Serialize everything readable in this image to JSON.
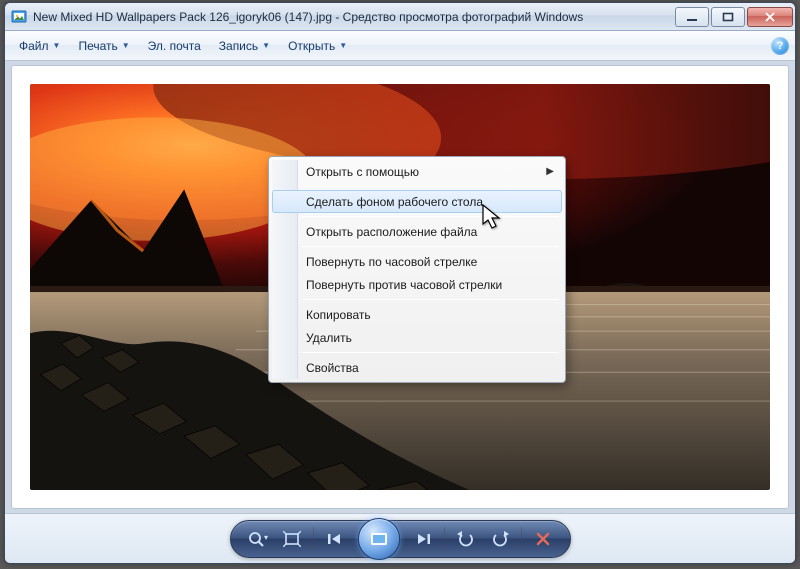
{
  "window": {
    "title": "New Mixed HD Wallpapers Pack 126_igoryk06 (147).jpg - Средство просмотра фотографий Windows"
  },
  "toolbar": {
    "file": "Файл",
    "print": "Печать",
    "email": "Эл. почта",
    "burn": "Запись",
    "open": "Открыть",
    "help_tooltip": "Справка"
  },
  "context_menu": {
    "open_with": "Открыть с помощью",
    "set_as_wallpaper": "Сделать фоном рабочего стола",
    "open_file_location": "Открыть расположение файла",
    "rotate_cw": "Повернуть по часовой стрелке",
    "rotate_ccw": "Повернуть против часовой стрелки",
    "copy": "Копировать",
    "delete": "Удалить",
    "properties": "Свойства"
  },
  "controls": {
    "zoom": "Изменить размер",
    "actual_size": "Реальный размер",
    "previous": "Предыдущее",
    "play_slideshow": "Показ слайдов",
    "next": "Следующее",
    "rotate_ccw": "Повернуть против часовой стрелки",
    "rotate_cw": "Повернуть по часовой стрелке",
    "delete": "Удалить"
  }
}
